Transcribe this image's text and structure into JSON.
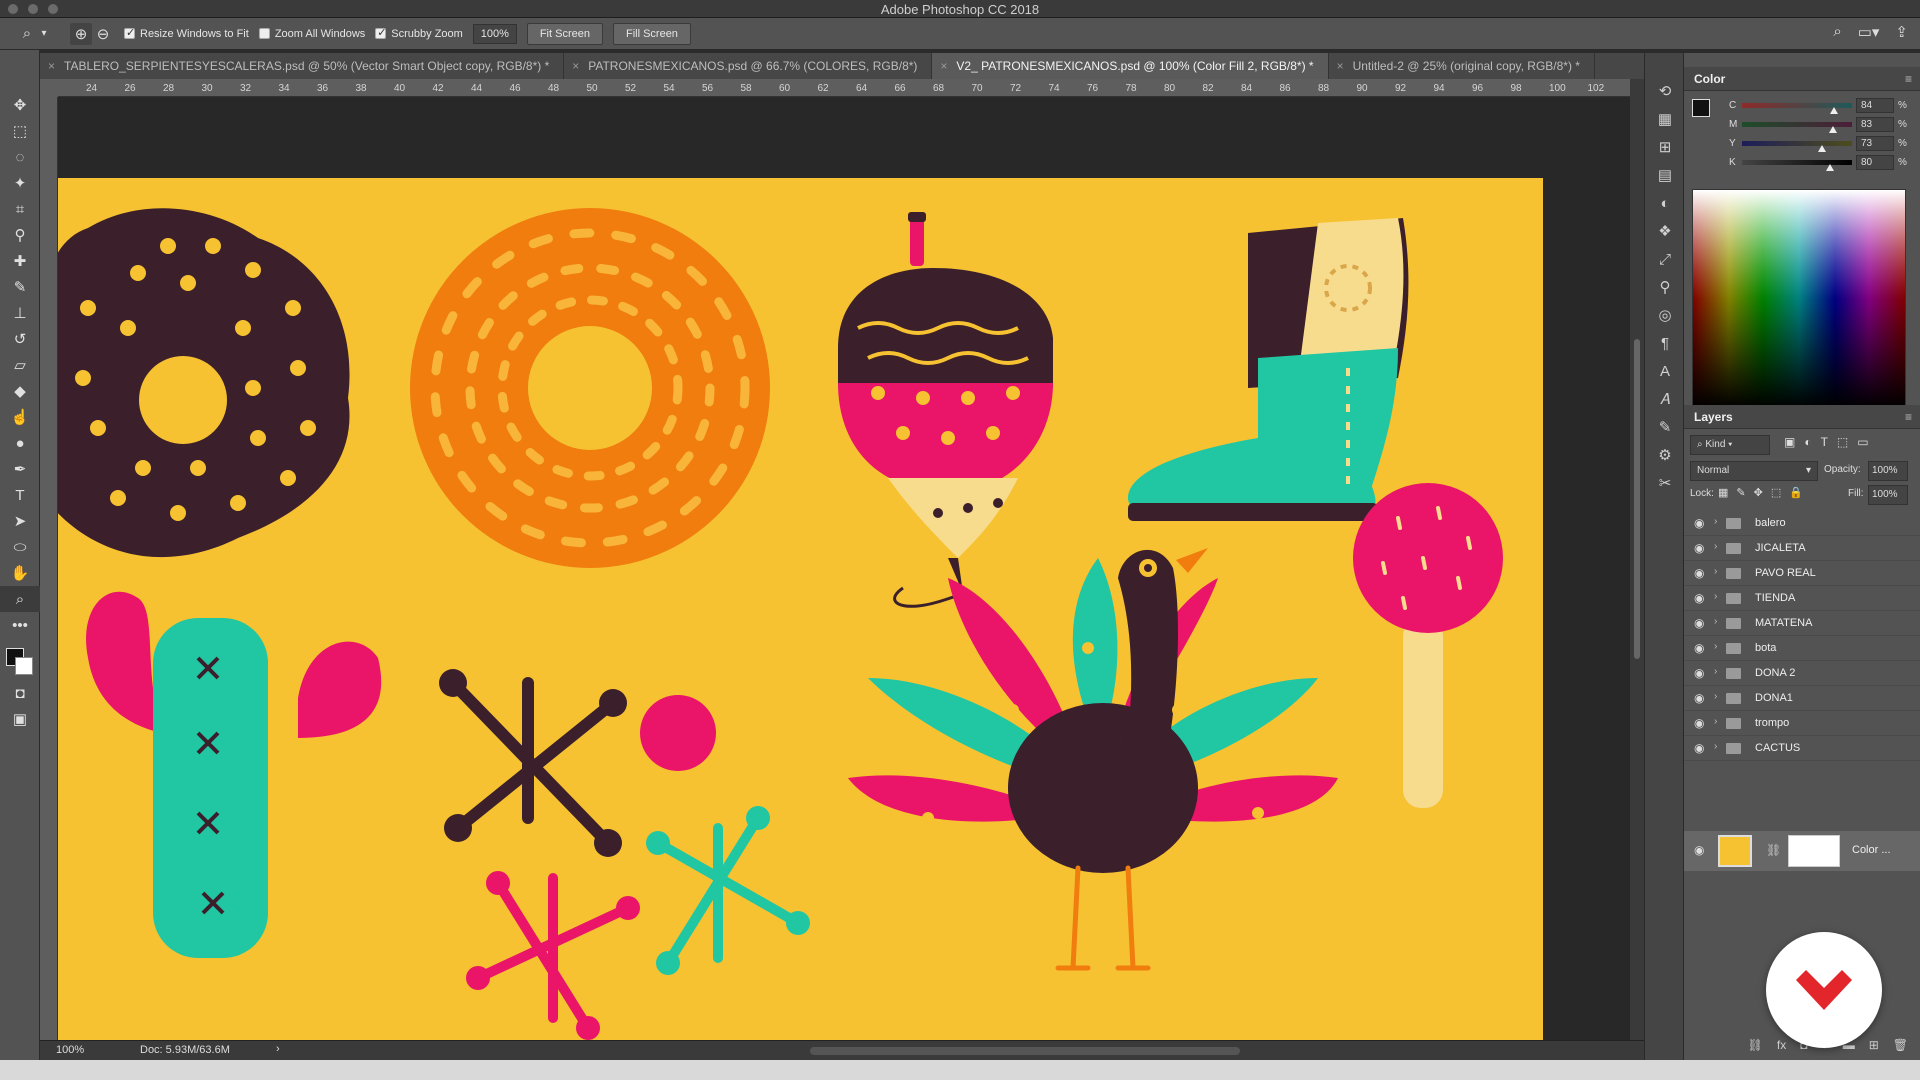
{
  "window": {
    "title": "Adobe Photoshop CC 2018"
  },
  "options_bar": {
    "resize_windows": {
      "label": "Resize Windows to Fit",
      "checked": true
    },
    "zoom_all": {
      "label": "Zoom All Windows",
      "checked": false
    },
    "scrubby": {
      "label": "Scrubby Zoom",
      "checked": true
    },
    "zoom_value": "100%",
    "fit_screen": "Fit Screen",
    "fill_screen": "Fill Screen"
  },
  "tabs": [
    {
      "label": "TABLERO_SERPIENTESYESCALERAS.psd @ 50% (Vector Smart Object copy, RGB/8*) *"
    },
    {
      "label": "PATRONESMEXICANOS.psd @ 66.7% (COLORES, RGB/8*)"
    },
    {
      "label": "V2_ PATRONESMEXICANOS.psd @ 100% (Color Fill 2, RGB/8*) *",
      "active": true
    },
    {
      "label": "Untitled-2 @ 25% (original copy, RGB/8*) *"
    }
  ],
  "ruler": {
    "h_ticks": [
      "24",
      "26",
      "28",
      "30",
      "32",
      "34",
      "36",
      "38",
      "40",
      "42",
      "44",
      "46",
      "48",
      "50",
      "52",
      "54",
      "56",
      "58",
      "60",
      "62",
      "64",
      "66",
      "68",
      "70",
      "72",
      "74",
      "76",
      "78",
      "80",
      "82",
      "84",
      "86",
      "88",
      "90",
      "92",
      "94",
      "96",
      "98",
      "100",
      "102"
    ]
  },
  "status": {
    "zoom": "100%",
    "doc": "Doc: 5.93M/63.6M",
    "arrow": "›"
  },
  "color_panel": {
    "title": "Color",
    "channels": [
      {
        "label": "C",
        "value": "84",
        "unit": "%",
        "level": 0.84
      },
      {
        "label": "M",
        "value": "83",
        "unit": "%",
        "level": 0.83
      },
      {
        "label": "Y",
        "value": "73",
        "unit": "%",
        "level": 0.73
      },
      {
        "label": "K",
        "value": "80",
        "unit": "%",
        "level": 0.8
      }
    ]
  },
  "layers_panel": {
    "title": "Layers",
    "kind": "Kind",
    "blend_mode": "Normal",
    "opacity_label": "Opacity:",
    "opacity": "100%",
    "lock_label": "Lock:",
    "fill_label": "Fill:",
    "fill": "100%",
    "groups": [
      "balero",
      "JICALETA",
      "PAVO REAL",
      "TIENDA",
      "MATATENA",
      "bota",
      "DONA 2",
      "DONA1",
      "trompo",
      "CACTUS"
    ],
    "fill_layer_name": "Color ..."
  },
  "colors": {
    "artboard": "#f6c231",
    "brown": "#3b1f2b",
    "orange": "#f07d0e",
    "pink": "#ea1468",
    "teal": "#21c6a3",
    "cream": "#f7dc8e"
  }
}
